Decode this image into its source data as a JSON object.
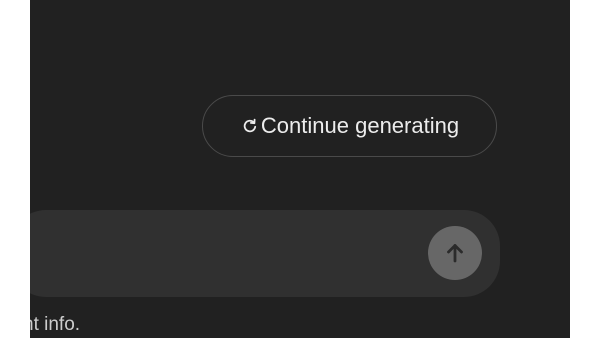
{
  "continue_button": {
    "label": "Continue generating",
    "icon": "refresh-icon"
  },
  "composer": {
    "send_icon": "arrow-up-icon"
  },
  "footer": {
    "note": "nt info."
  },
  "colors": {
    "background": "#212121",
    "composer": "#303030",
    "send_button": "#676767",
    "text": "#ececec"
  }
}
